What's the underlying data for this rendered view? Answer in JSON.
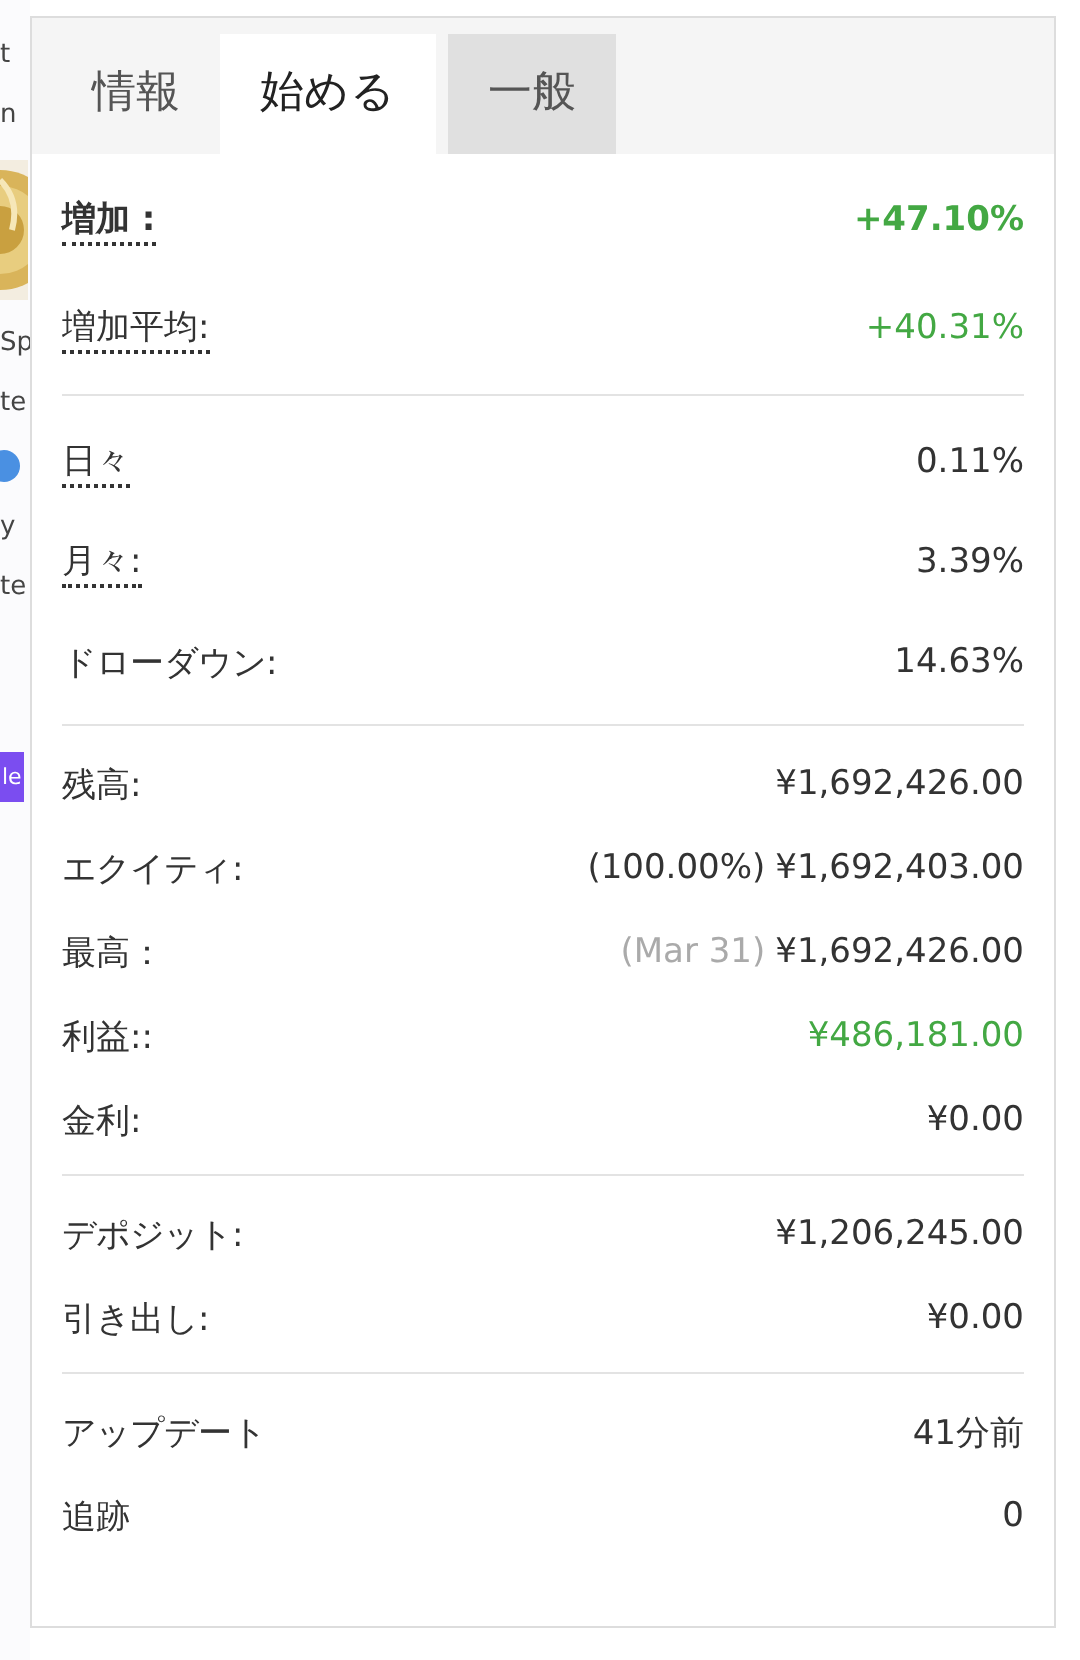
{
  "background_fragments": [
    {
      "text": "t",
      "kind": "text"
    },
    {
      "text": "n",
      "kind": "text"
    },
    {
      "kind": "picture"
    },
    {
      "text": "Sp",
      "kind": "text"
    },
    {
      "text": "te",
      "kind": "text"
    },
    {
      "kind": "icon"
    },
    {
      "text": "y",
      "kind": "text"
    },
    {
      "text": "te",
      "kind": "text"
    },
    {
      "text": "le",
      "kind": "button"
    }
  ],
  "tabs": [
    {
      "label": "情報",
      "selected": false,
      "hovered": false
    },
    {
      "label": "始める",
      "selected": true,
      "hovered": false
    },
    {
      "label": "一般",
      "selected": false,
      "hovered": true
    }
  ],
  "sections": [
    {
      "rows": [
        {
          "label": "増加 :",
          "value": "+47.10%",
          "bold": true,
          "dotted": true,
          "positive": true
        },
        {
          "label": "増加平均:",
          "value": "+40.31%",
          "bold": false,
          "dotted": true,
          "positive": true
        }
      ]
    },
    {
      "rows": [
        {
          "label": "日々",
          "value": "0.11%",
          "bold": false,
          "dotted": true,
          "positive": false
        },
        {
          "label": "月々:",
          "value": "3.39%",
          "bold": false,
          "dotted": true,
          "positive": false
        },
        {
          "label": "ドローダウン:",
          "value": "14.63%",
          "bold": false,
          "dotted": false,
          "positive": false
        }
      ]
    },
    {
      "rows": [
        {
          "label": "残高:",
          "value": "¥1,692,426.00",
          "bold": false,
          "dotted": false,
          "positive": false
        },
        {
          "label": "エクイティ:",
          "prefix": "(100.00%)",
          "muted_prefix": false,
          "value": "¥1,692,403.00",
          "bold": false,
          "dotted": false,
          "positive": false
        },
        {
          "label": "最高：",
          "prefix": "(Mar 31)",
          "muted_prefix": true,
          "value": "¥1,692,426.00",
          "bold": false,
          "dotted": false,
          "positive": false
        },
        {
          "label": "利益::",
          "value": "¥486,181.00",
          "bold": false,
          "dotted": false,
          "positive": true
        },
        {
          "label": "金利:",
          "value": "¥0.00",
          "bold": false,
          "dotted": false,
          "positive": false
        }
      ]
    },
    {
      "rows": [
        {
          "label": "デポジット:",
          "value": "¥1,206,245.00",
          "bold": false,
          "dotted": false,
          "positive": false
        },
        {
          "label": "引き出し:",
          "value": "¥0.00",
          "bold": false,
          "dotted": false,
          "positive": false
        }
      ]
    },
    {
      "rows": [
        {
          "label": "アップデート",
          "value": "41分前",
          "bold": false,
          "dotted": false,
          "positive": false
        },
        {
          "label": "追跡",
          "value": "0",
          "bold": false,
          "dotted": false,
          "positive": false
        }
      ]
    }
  ]
}
